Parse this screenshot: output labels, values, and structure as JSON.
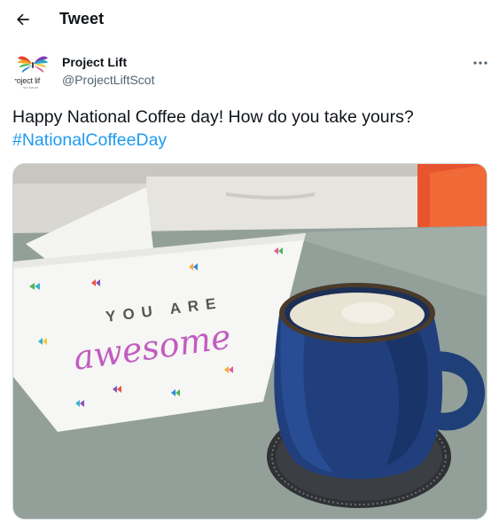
{
  "header": {
    "title": "Tweet",
    "back_icon": "arrow-left-icon"
  },
  "author": {
    "display_name": "Project Lift",
    "handle": "@ProjectLiftScot",
    "avatar_text": "roject lif",
    "avatar_subtext": "your future"
  },
  "tweet": {
    "text": "Happy National Coffee day! How do you take yours?",
    "hashtag": "#NationalCoffeeDay"
  },
  "photo": {
    "card_line1": "YOU ARE",
    "card_line2": "awesome"
  },
  "colors": {
    "accent": "#1d9bf0",
    "text": "#0f1419",
    "muted": "#536471"
  }
}
